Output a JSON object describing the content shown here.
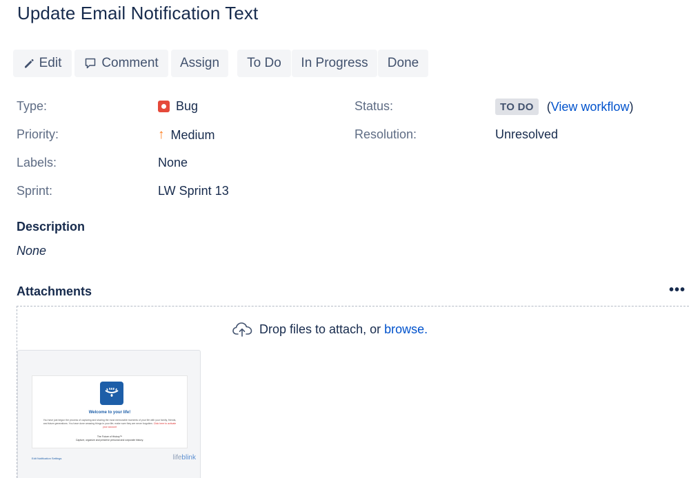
{
  "issue": {
    "title": "Update Email Notification Text"
  },
  "toolbar": {
    "edit": "Edit",
    "comment": "Comment",
    "assign": "Assign",
    "todo": "To Do",
    "in_progress": "In Progress",
    "done": "Done"
  },
  "details": {
    "type_label": "Type:",
    "type_value": "Bug",
    "priority_label": "Priority:",
    "priority_value": "Medium",
    "labels_label": "Labels:",
    "labels_value": "None",
    "sprint_label": "Sprint:",
    "sprint_value": "LW Sprint 13",
    "status_label": "Status:",
    "status_value": "TO DO",
    "view_workflow_open": "(",
    "view_workflow": "View workflow",
    "view_workflow_close": ")",
    "resolution_label": "Resolution:",
    "resolution_value": "Unresolved"
  },
  "description": {
    "heading": "Description",
    "value": "None"
  },
  "attachments": {
    "heading": "Attachments",
    "drop_text": "Drop files to attach, or ",
    "browse": "browse.",
    "thumbnail": {
      "email_heading": "Welcome to your life!",
      "email_body": "You have just begun the process of capturing and sharing the most memorable moments of your life with your family, friends, and future generations. You have done amazing things in your life; make sure they are never forgotten.",
      "email_link": "Click here to activate your account",
      "email_footer_1": "The Future of History™",
      "email_footer_2": "Capture, organize and preserve personal and corporate history.",
      "settings_link": "Edit Notification Settings",
      "brand_a": "life",
      "brand_b": "blink"
    }
  },
  "colors": {
    "text_primary": "#172b4d",
    "text_secondary": "#5e6c84",
    "link": "#0052cc",
    "button_bg": "#f4f5f7",
    "bug": "#e5493a",
    "priority_medium": "#ff7d1b",
    "status_badge_bg": "#dfe1e6"
  }
}
